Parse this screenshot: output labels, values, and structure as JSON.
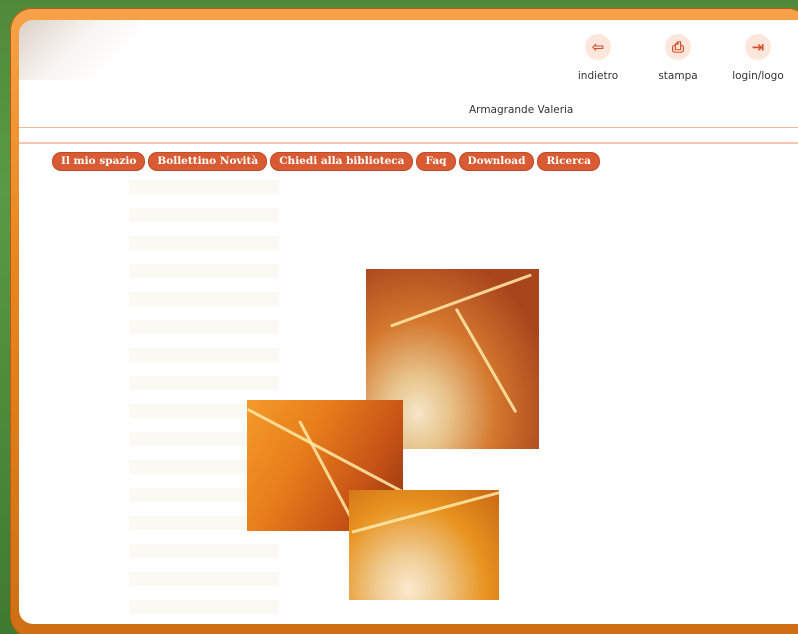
{
  "toolbar": {
    "items": [
      {
        "label": "indietro",
        "icon": "back-icon"
      },
      {
        "label": "stampa",
        "icon": "print-icon"
      },
      {
        "label": "login/logo",
        "icon": "login-icon"
      }
    ]
  },
  "header": {
    "user_name": "Armagrande Valeria"
  },
  "nav": {
    "tabs": [
      {
        "label": "Il mio spazio"
      },
      {
        "label": "Bollettino Novità"
      },
      {
        "label": "Chiedi alla biblioteca"
      },
      {
        "label": "Faq"
      },
      {
        "label": "Download"
      },
      {
        "label": "Ricerca"
      }
    ]
  },
  "colors": {
    "accent": "#d95b33",
    "frame": "#e9861f",
    "background": "#4f8a3b"
  }
}
